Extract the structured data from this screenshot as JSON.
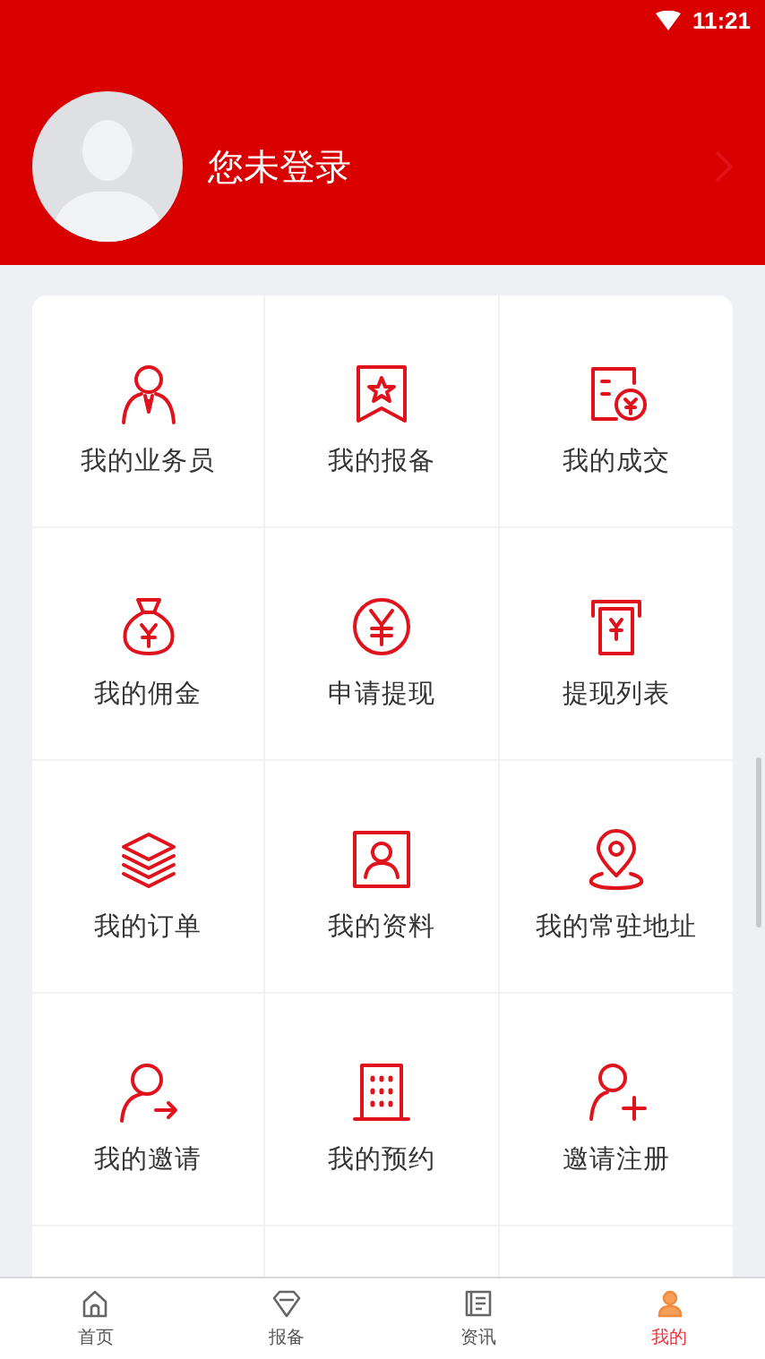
{
  "status_bar": {
    "time": "11:21"
  },
  "profile": {
    "name": "您未登录"
  },
  "menu": [
    {
      "label": "我的业务员"
    },
    {
      "label": "我的报备"
    },
    {
      "label": "我的成交"
    },
    {
      "label": "我的佣金"
    },
    {
      "label": "申请提现"
    },
    {
      "label": "提现列表"
    },
    {
      "label": "我的订单"
    },
    {
      "label": "我的资料"
    },
    {
      "label": "我的常驻地址"
    },
    {
      "label": "我的邀请"
    },
    {
      "label": "我的预约"
    },
    {
      "label": "邀请注册"
    }
  ],
  "tabs": [
    {
      "label": "首页",
      "selected": false
    },
    {
      "label": "报备",
      "selected": false
    },
    {
      "label": "资讯",
      "selected": false
    },
    {
      "label": "我的",
      "selected": true
    }
  ]
}
